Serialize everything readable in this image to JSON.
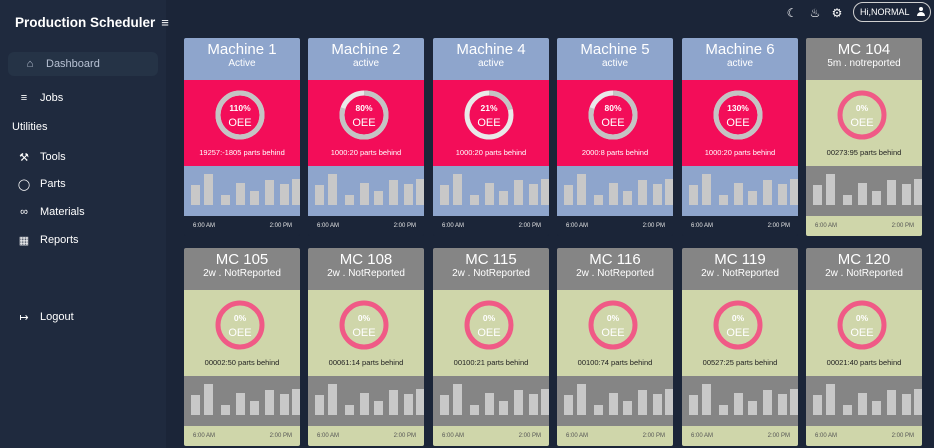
{
  "app": {
    "title": "Production Scheduler"
  },
  "sidebar": {
    "dashboard": "Dashboard",
    "jobs": "Jobs",
    "section": "Utilities",
    "tools": "Tools",
    "parts": "Parts",
    "materials": "Materials",
    "reports": "Reports",
    "logout": "Logout"
  },
  "topbar": {
    "user": "Hi,NORMAL"
  },
  "colors": {
    "active_mid": "#f30d59",
    "active_head": "#8ea5cc",
    "inactive_mid": "#cfd6aa",
    "inactive_head": "#858585"
  },
  "machines": [
    {
      "name": "Machine 1",
      "status": "Active",
      "oee": "110%",
      "oee_value": 110,
      "oee_label": "OEE",
      "parts": "19257:-1805 parts behind",
      "start": "6:00 AM",
      "end": "2:00 PM",
      "bars": [
        0.52,
        0.82,
        0.25,
        0.58,
        0.36,
        0.65,
        0.55,
        0.68
      ]
    },
    {
      "name": "Machine 2",
      "status": "active",
      "oee": "80%",
      "oee_value": 80,
      "oee_label": "OEE",
      "parts": "1000:20 parts behind",
      "start": "6:00 AM",
      "end": "2:00 PM",
      "bars": [
        0.52,
        0.82,
        0.25,
        0.58,
        0.36,
        0.65,
        0.55,
        0.68
      ]
    },
    {
      "name": "Machine 4",
      "status": "active",
      "oee": "21%",
      "oee_value": 21,
      "oee_label": "OEE",
      "parts": "1000:20 parts behind",
      "start": "6:00 AM",
      "end": "2:00 PM",
      "bars": [
        0.52,
        0.82,
        0.25,
        0.58,
        0.36,
        0.65,
        0.55,
        0.68
      ]
    },
    {
      "name": "Machine 5",
      "status": "active",
      "oee": "80%",
      "oee_value": 80,
      "oee_label": "OEE",
      "parts": "2000:8 parts behind",
      "start": "6:00 AM",
      "end": "2:00 PM",
      "bars": [
        0.52,
        0.82,
        0.25,
        0.58,
        0.36,
        0.65,
        0.55,
        0.68
      ]
    },
    {
      "name": "Machine 6",
      "status": "active",
      "oee": "130%",
      "oee_value": 130,
      "oee_label": "OEE",
      "parts": "1000:20 parts behind",
      "start": "6:00 AM",
      "end": "2:00 PM",
      "bars": [
        0.52,
        0.82,
        0.25,
        0.58,
        0.36,
        0.65,
        0.55,
        0.68
      ]
    },
    {
      "name": "MC 104",
      "status": "5m . notreported",
      "oee": "0%",
      "oee_value": 0,
      "oee_label": "OEE",
      "parts": "00273:95 parts behind",
      "start": "6:00 AM",
      "end": "2:00 PM",
      "bars": [
        0.52,
        0.82,
        0.25,
        0.58,
        0.36,
        0.65,
        0.55,
        0.68
      ]
    },
    {
      "name": "MC 105",
      "status": "2w . NotReported",
      "oee": "0%",
      "oee_value": 0,
      "oee_label": "OEE",
      "parts": "00002:50 parts behind",
      "start": "6:00 AM",
      "end": "2:00 PM",
      "bars": [
        0.52,
        0.82,
        0.25,
        0.58,
        0.36,
        0.65,
        0.55,
        0.68
      ]
    },
    {
      "name": "MC 108",
      "status": "2w . NotReported",
      "oee": "0%",
      "oee_value": 0,
      "oee_label": "OEE",
      "parts": "00061:14 parts behind",
      "start": "6:00 AM",
      "end": "2:00 PM",
      "bars": [
        0.52,
        0.82,
        0.25,
        0.58,
        0.36,
        0.65,
        0.55,
        0.68
      ]
    },
    {
      "name": "MC 115",
      "status": "2w . NotReported",
      "oee": "0%",
      "oee_value": 0,
      "oee_label": "OEE",
      "parts": "00100:21 parts behind",
      "start": "6:00 AM",
      "end": "2:00 PM",
      "bars": [
        0.52,
        0.82,
        0.25,
        0.58,
        0.36,
        0.65,
        0.55,
        0.68
      ]
    },
    {
      "name": "MC 116",
      "status": "2w . NotReported",
      "oee": "0%",
      "oee_value": 0,
      "oee_label": "OEE",
      "parts": "00100:74 parts behind",
      "start": "6:00 AM",
      "end": "2:00 PM",
      "bars": [
        0.52,
        0.82,
        0.25,
        0.58,
        0.36,
        0.65,
        0.55,
        0.68
      ]
    },
    {
      "name": "MC 119",
      "status": "2w . NotReported",
      "oee": "0%",
      "oee_value": 0,
      "oee_label": "OEE",
      "parts": "00527:25 parts behind",
      "start": "6:00 AM",
      "end": "2:00 PM",
      "bars": [
        0.52,
        0.82,
        0.25,
        0.58,
        0.36,
        0.65,
        0.55,
        0.68
      ]
    },
    {
      "name": "MC 120",
      "status": "2w . NotReported",
      "oee": "0%",
      "oee_value": 0,
      "oee_label": "OEE",
      "parts": "00021:40 parts behind",
      "start": "6:00 AM",
      "end": "2:00 PM",
      "bars": [
        0.52,
        0.82,
        0.25,
        0.58,
        0.36,
        0.65,
        0.55,
        0.68
      ]
    }
  ]
}
